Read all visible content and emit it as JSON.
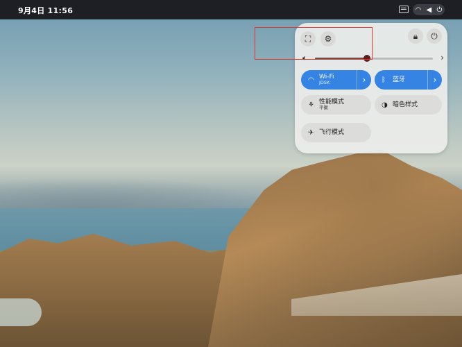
{
  "topbar": {
    "clock": "9月4日  11:56"
  },
  "quick_settings": {
    "screenshot_label": "",
    "settings_label": "",
    "lock_label": "",
    "power_label": "",
    "volume": {
      "level": 0.44
    },
    "tiles": [
      {
        "label": "Wi-Fi",
        "sub": "JDSK",
        "active": true
      },
      {
        "label": "蓝牙",
        "sub": "",
        "active": true
      },
      {
        "label": "性能模式",
        "sub": "平衡",
        "active": false
      },
      {
        "label": "暗色样式",
        "sub": "",
        "active": false
      },
      {
        "label": "飞行模式",
        "sub": "",
        "active": false
      }
    ]
  },
  "colors": {
    "accent": "#3584e4",
    "annotation": "#e1332d"
  }
}
